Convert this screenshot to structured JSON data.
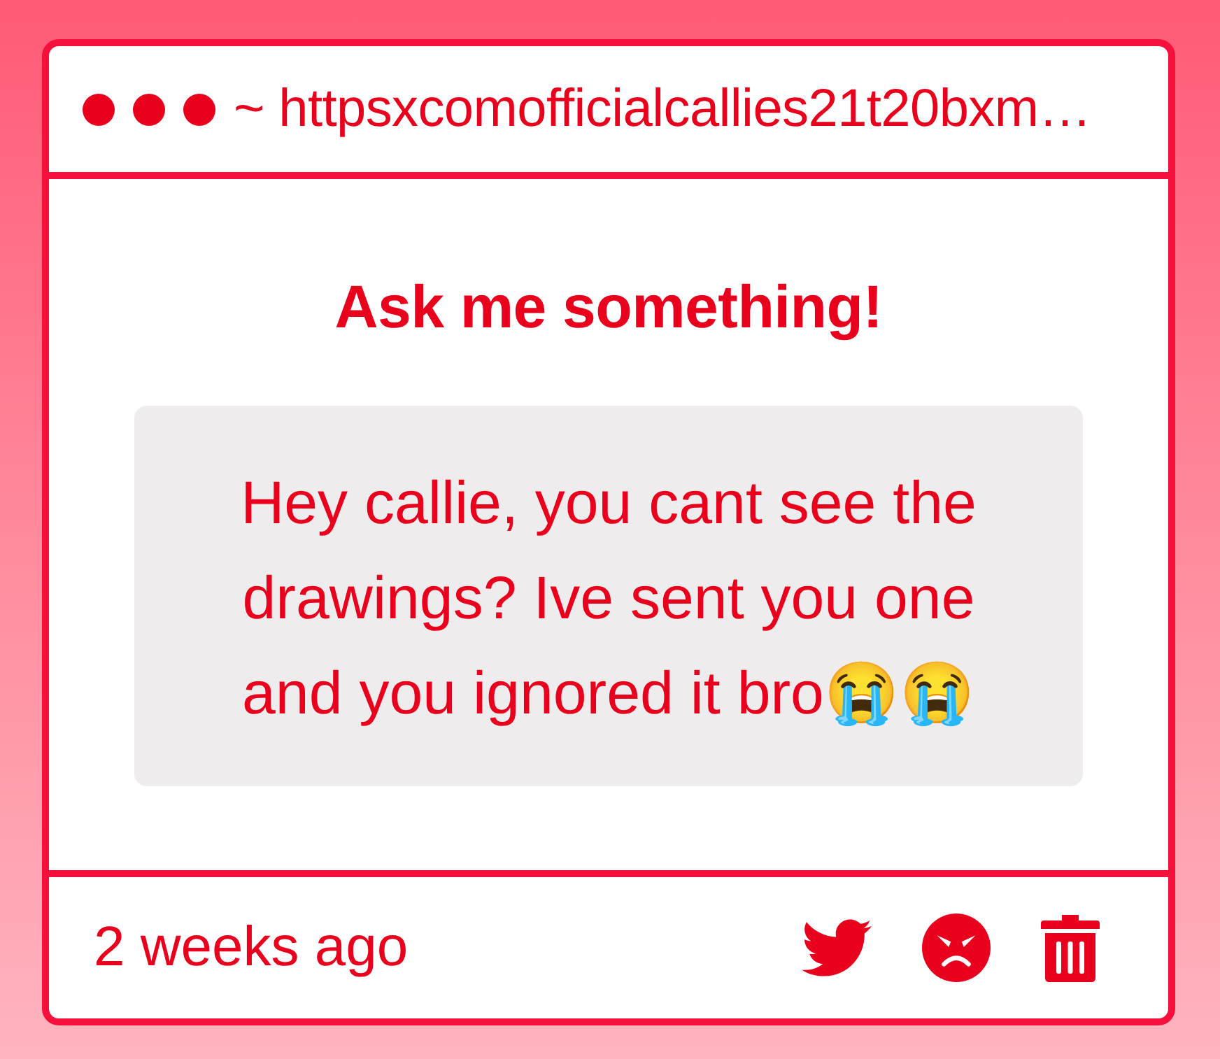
{
  "window": {
    "title": "~ httpsxcomofficialcallies21t20bxm…"
  },
  "prompt": {
    "heading": "Ask me something!"
  },
  "message": {
    "text": "Hey callie, you cant see the drawings? Ive sent you one and you ignored it bro😭😭"
  },
  "footer": {
    "time": "2 weeks ago",
    "actions": [
      {
        "kind": "bird"
      },
      {
        "kind": "angry-face"
      },
      {
        "kind": "trash"
      }
    ]
  }
}
